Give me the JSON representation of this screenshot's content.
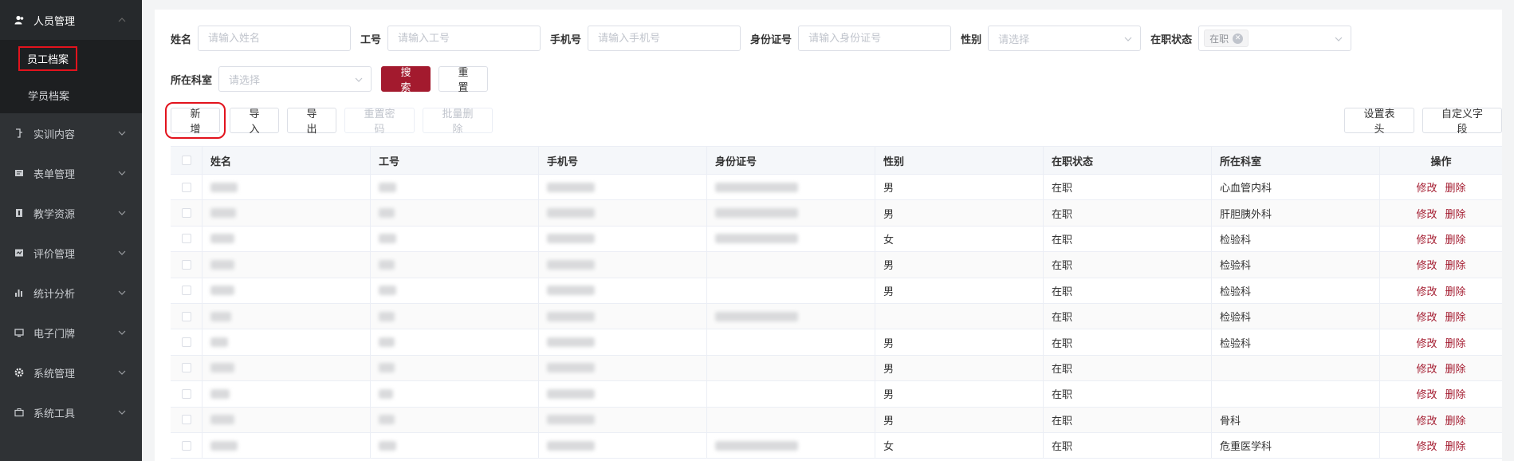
{
  "sidebar": {
    "top": {
      "label": "人员管理",
      "icon": "user-icon"
    },
    "sub": [
      {
        "label": "员工档案",
        "active": true
      },
      {
        "label": "学员档案",
        "active": false
      }
    ],
    "items": [
      {
        "label": "实训内容",
        "icon": "training-icon"
      },
      {
        "label": "表单管理",
        "icon": "form-icon"
      },
      {
        "label": "教学资源",
        "icon": "resource-icon"
      },
      {
        "label": "评价管理",
        "icon": "evaluate-icon"
      },
      {
        "label": "统计分析",
        "icon": "bar-chart-icon"
      },
      {
        "label": "电子门牌",
        "icon": "monitor-icon"
      },
      {
        "label": "系统管理",
        "icon": "gear-icon"
      },
      {
        "label": "系统工具",
        "icon": "toolbox-icon"
      }
    ]
  },
  "filters": {
    "name_label": "姓名",
    "name_placeholder": "请输入姓名",
    "id_label": "工号",
    "id_placeholder": "请输入工号",
    "phone_label": "手机号",
    "phone_placeholder": "请输入手机号",
    "idcard_label": "身份证号",
    "idcard_placeholder": "请输入身份证号",
    "gender_label": "性别",
    "gender_placeholder": "请选择",
    "status_label": "在职状态",
    "status_tag": "在职",
    "dept_label": "所在科室",
    "dept_placeholder": "请选择",
    "search": "搜索",
    "reset": "重置"
  },
  "toolbar": {
    "add": "新增",
    "import": "导入",
    "export": "导出",
    "reset_pwd": "重置密码",
    "batch_delete": "批量删除",
    "set_header": "设置表头",
    "custom_field": "自定义字段"
  },
  "table": {
    "headers": [
      "姓名",
      "工号",
      "手机号",
      "身份证号",
      "性别",
      "在职状态",
      "所在科室",
      "操作"
    ],
    "edit": "修改",
    "delete": "删除",
    "rows": [
      {
        "gender": "男",
        "status": "在职",
        "dept": "心血管内科"
      },
      {
        "gender": "男",
        "status": "在职",
        "dept": "肝胆胰外科"
      },
      {
        "gender": "女",
        "status": "在职",
        "dept": "检验科"
      },
      {
        "gender": "男",
        "status": "在职",
        "dept": "检验科"
      },
      {
        "gender": "男",
        "status": "在职",
        "dept": "检验科"
      },
      {
        "gender": "",
        "status": "在职",
        "dept": "检验科"
      },
      {
        "gender": "男",
        "status": "在职",
        "dept": "检验科"
      },
      {
        "gender": "男",
        "status": "在职",
        "dept": ""
      },
      {
        "gender": "男",
        "status": "在职",
        "dept": ""
      },
      {
        "gender": "男",
        "status": "在职",
        "dept": "骨科"
      },
      {
        "gender": "女",
        "status": "在职",
        "dept": "危重医学科"
      }
    ]
  }
}
